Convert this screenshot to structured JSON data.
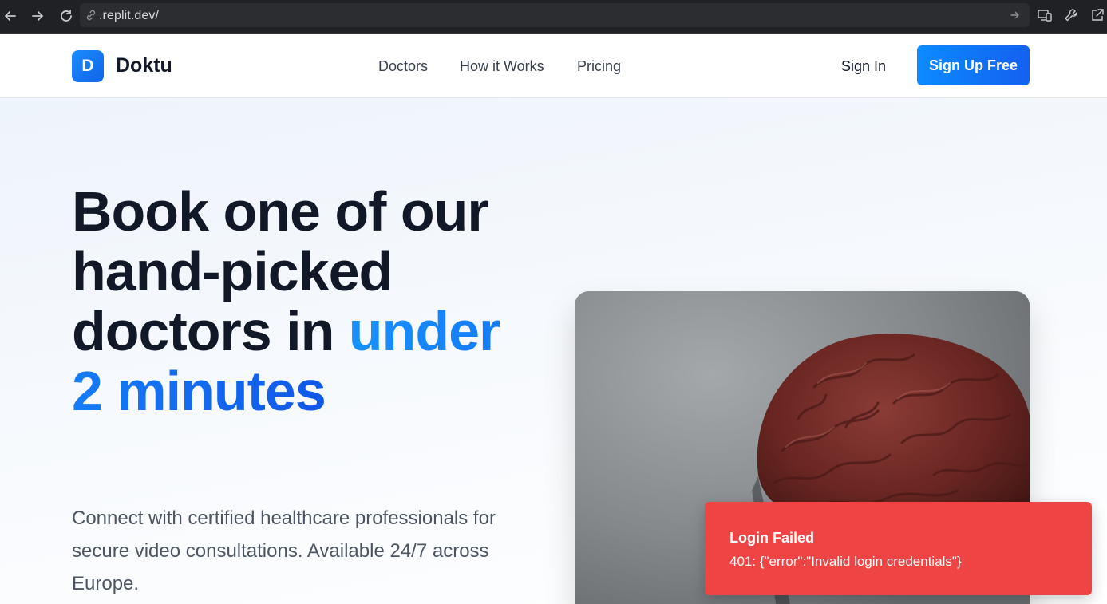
{
  "browser": {
    "url": ".replit.dev/"
  },
  "header": {
    "logo_letter": "D",
    "logo_text": "Doktu",
    "nav": [
      "Doctors",
      "How it Works",
      "Pricing"
    ],
    "sign_in": "Sign In",
    "sign_up": "Sign Up Free"
  },
  "hero": {
    "headline_part1": "Book one of our hand-picked doctors in ",
    "headline_accent": "under 2 minutes",
    "subtext": "Connect with certified healthcare professionals for secure video consultations. Available 24/7 across Europe."
  },
  "toast": {
    "title": "Login Failed",
    "message": "401: {\"error\":\"Invalid login credentials\"}"
  },
  "colors": {
    "accent": "#1270f5",
    "toast_bg": "#ef4444"
  }
}
